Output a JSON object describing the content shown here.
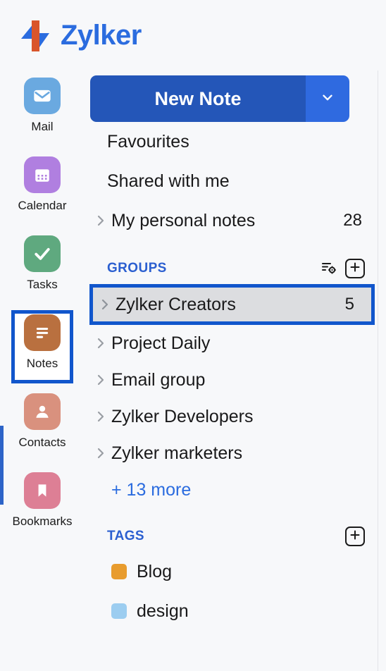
{
  "brand": {
    "name": "Zylker",
    "logo_colors": {
      "blue": "#2b6cdf",
      "orange": "#d9552b"
    },
    "text_color": "#2b6cdf"
  },
  "rail": {
    "items": [
      {
        "label": "Mail",
        "icon": "mail-icon",
        "color": "#6aa9e0",
        "active": false
      },
      {
        "label": "Calendar",
        "icon": "calendar-icon",
        "color": "#b07fe0",
        "active": false
      },
      {
        "label": "Tasks",
        "icon": "check-icon",
        "color": "#5fa97f",
        "active": false
      },
      {
        "label": "Notes",
        "icon": "notes-icon",
        "color": "#b9703f",
        "active": true
      },
      {
        "label": "Contacts",
        "icon": "contact-icon",
        "color": "#d9917e",
        "active": false
      },
      {
        "label": "Bookmarks",
        "icon": "bookmark-icon",
        "color": "#dd7f95",
        "active": false
      }
    ],
    "accent_color": "#2d64c8",
    "selection_border_color": "#1156cc"
  },
  "panel": {
    "new_note": {
      "label": "New Note",
      "caret_icon": "chevron-down-icon",
      "main_color": "#2456b8",
      "caret_color": "#2f6ae0"
    },
    "nav_items": [
      {
        "label": "Favourites",
        "has_chevron": false,
        "count": ""
      },
      {
        "label": "Shared with me",
        "has_chevron": false,
        "count": ""
      },
      {
        "label": "My personal notes",
        "has_chevron": true,
        "count": "28"
      }
    ],
    "groups_section": {
      "title": "GROUPS",
      "settings_icon": "sort-settings-icon",
      "add_icon": "plus-icon",
      "items": [
        {
          "label": "Zylker Creators",
          "count": "5",
          "selected": true
        },
        {
          "label": "Project Daily",
          "count": "",
          "selected": false
        },
        {
          "label": "Email group",
          "count": "",
          "selected": false
        },
        {
          "label": "Zylker Developers",
          "count": "",
          "selected": false
        },
        {
          "label": "Zylker marketers",
          "count": "",
          "selected": false
        }
      ],
      "more_label": "+ 13 more"
    },
    "tags_section": {
      "title": "TAGS",
      "add_icon": "plus-icon",
      "items": [
        {
          "label": "Blog",
          "color": "#e89c2e"
        },
        {
          "label": "design",
          "color": "#9ccdf0"
        }
      ]
    },
    "section_title_color": "#2b5fd0",
    "selection_border_color": "#1156cc",
    "selection_fill_color": "#dcdde0"
  }
}
